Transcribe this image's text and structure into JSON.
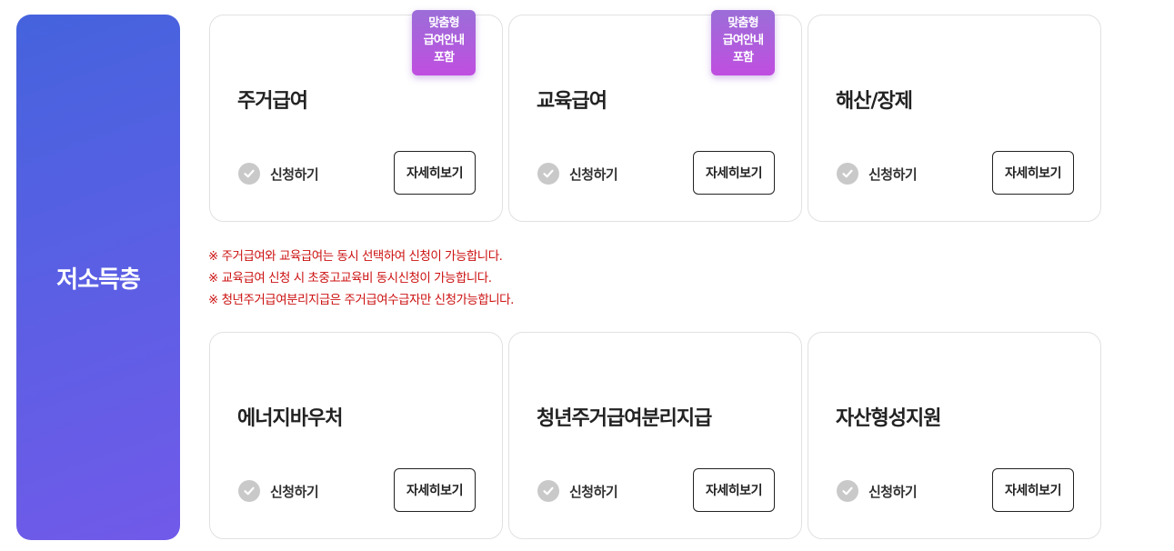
{
  "category": {
    "title": "저소득층"
  },
  "badge": {
    "line1": "맞춤형",
    "line2": "급여안내",
    "line3": "포함"
  },
  "cards_top": [
    {
      "title": "주거급여",
      "apply_label": "신청하기",
      "detail_label": "자세히보기",
      "badge": true
    },
    {
      "title": "교육급여",
      "apply_label": "신청하기",
      "detail_label": "자세히보기",
      "badge": true
    },
    {
      "title": "해산/장제",
      "apply_label": "신청하기",
      "detail_label": "자세히보기",
      "badge": false
    }
  ],
  "notes": [
    "※ 주거급여와 교육급여는 동시 선택하여 신청이 가능합니다.",
    "※ 교육급여 신청 시 초중고교육비 동시신청이 가능합니다.",
    "※ 청년주거급여분리지급은 주거급여수급자만 신청가능합니다."
  ],
  "cards_bottom": [
    {
      "title": "에너지바우처",
      "apply_label": "신청하기",
      "detail_label": "자세히보기",
      "badge": false
    },
    {
      "title": "청년주거급여분리지급",
      "apply_label": "신청하기",
      "detail_label": "자세히보기",
      "badge": false
    },
    {
      "title": "자산형성지원",
      "apply_label": "신청하기",
      "detail_label": "자세히보기",
      "badge": false
    }
  ],
  "colors": {
    "category_gradient_start": "#4563dd",
    "category_gradient_end": "#715ae9",
    "badge_gradient_start": "#9b6ed8",
    "badge_gradient_end": "#c04ee0",
    "note_text": "#cc1111",
    "check_icon_bg": "#c9c9c9"
  },
  "icons": {
    "apply_icon": "check-circle-icon"
  }
}
